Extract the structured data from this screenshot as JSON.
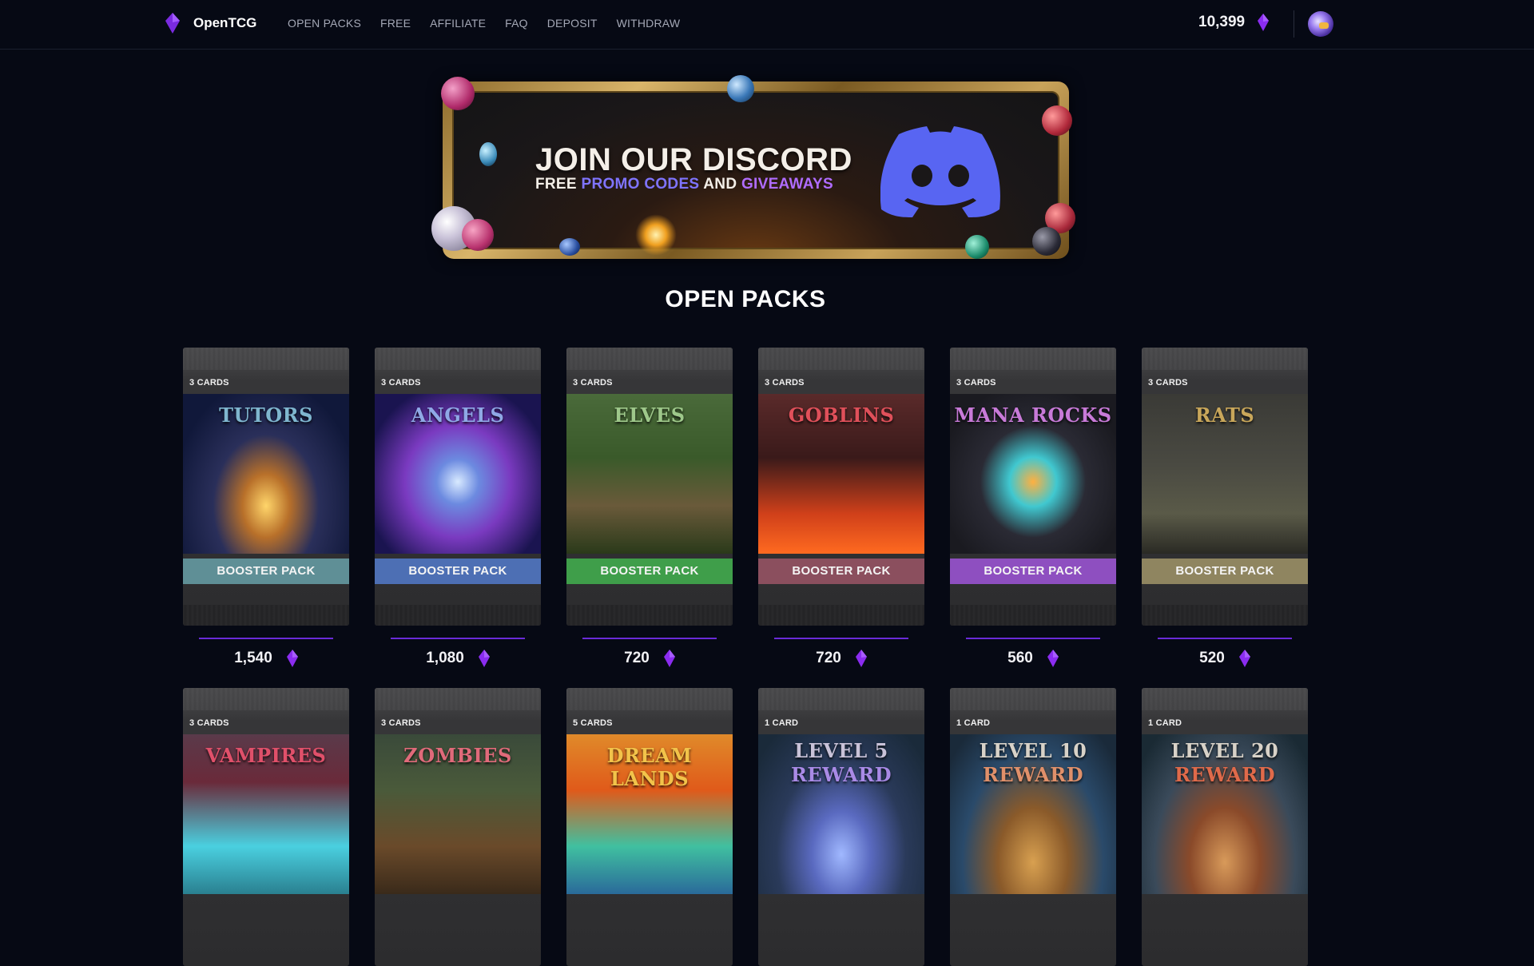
{
  "brand": {
    "name": "OpenTCG"
  },
  "nav": {
    "links": [
      "OPEN PACKS",
      "FREE",
      "AFFILIATE",
      "FAQ",
      "DEPOSIT",
      "WITHDRAW"
    ]
  },
  "wallet": {
    "balance": "10,399"
  },
  "banner": {
    "title": "JOIN OUR DISCORD",
    "sub_free": "FREE",
    "sub_promo": "PROMO CODES",
    "sub_and": "AND",
    "sub_giveaways": "GIVEAWAYS"
  },
  "section": {
    "title": "OPEN PACKS"
  },
  "colors": {
    "accent": "#6a2bd8",
    "gem": "#8b2cf0",
    "background": "#060914"
  },
  "packs": [
    {
      "count": "3 CARDS",
      "name": "TUTORS",
      "ribbon": "BOOSTER PACK",
      "price": "1,540",
      "ribbon_color": "#5f8f96",
      "name_color": "#7fb6cf",
      "art": "tutors"
    },
    {
      "count": "3 CARDS",
      "name": "ANGELS",
      "ribbon": "BOOSTER PACK",
      "price": "1,080",
      "ribbon_color": "#4d6fb4",
      "name_color": "#8fa8e6",
      "art": "angels"
    },
    {
      "count": "3 CARDS",
      "name": "ELVES",
      "ribbon": "BOOSTER PACK",
      "price": "720",
      "ribbon_color": "#3f9e4a",
      "name_color": "#9ec88a",
      "art": "elves"
    },
    {
      "count": "3 CARDS",
      "name": "GOBLINS",
      "ribbon": "BOOSTER PACK",
      "price": "720",
      "ribbon_color": "#8b4f5e",
      "name_color": "#e0505a",
      "art": "goblins"
    },
    {
      "count": "3 CARDS",
      "name": "MANA ROCKS",
      "ribbon": "BOOSTER PACK",
      "price": "560",
      "ribbon_color": "#8e4fc0",
      "name_color": "#c87ad8",
      "art": "mana"
    },
    {
      "count": "3 CARDS",
      "name": "RATS",
      "ribbon": "BOOSTER PACK",
      "price": "520",
      "ribbon_color": "#8f8560",
      "name_color": "#c9a75a",
      "art": "rats"
    },
    {
      "count": "3 CARDS",
      "name": "VAMPIRES",
      "ribbon": "",
      "price": "",
      "ribbon_color": "",
      "name_color": "#e0506a",
      "art": "vampires"
    },
    {
      "count": "3 CARDS",
      "name": "ZOMBIES",
      "ribbon": "",
      "price": "",
      "ribbon_color": "",
      "name_color": "#e06a7a",
      "art": "zombies"
    },
    {
      "count": "5 CARDS",
      "name": "DREAM LANDS",
      "ribbon": "",
      "price": "",
      "ribbon_color": "",
      "name_color": "#f2c34a",
      "art": "dream"
    },
    {
      "count": "1 CARD",
      "name": "LEVEL 5",
      "name2": "REWARD",
      "ribbon": "",
      "price": "",
      "ribbon_color": "",
      "name_color": "#c9c2d8",
      "name2_color": "#a98ae6",
      "art": "lvl5"
    },
    {
      "count": "1 CARD",
      "name": "LEVEL 10",
      "name2": "REWARD",
      "ribbon": "",
      "price": "",
      "ribbon_color": "",
      "name_color": "#d8d2c8",
      "name2_color": "#e0906a",
      "art": "lvl10"
    },
    {
      "count": "1 CARD",
      "name": "LEVEL 20",
      "name2": "REWARD",
      "ribbon": "",
      "price": "",
      "ribbon_color": "",
      "name_color": "#d8d2c8",
      "name2_color": "#e06a4a",
      "art": "lvl20"
    }
  ]
}
